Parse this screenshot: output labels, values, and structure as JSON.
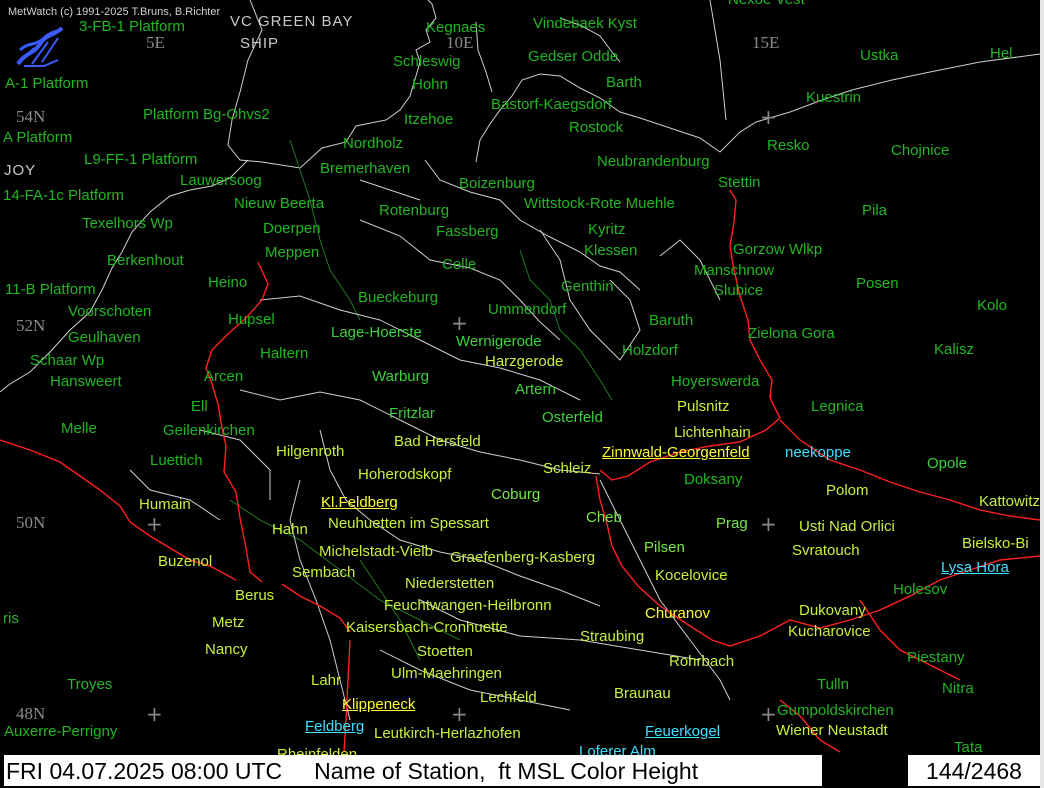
{
  "copyright": "MetWatch (c) 1991-2025 T.Bruns, B.Richter",
  "status_bar": {
    "datetime": "FRI 04.07.2025 08:00 UTC",
    "title": "Name of Station,  ft MSL Color Height",
    "counter": "144/2468"
  },
  "grid_labels": {
    "lon_5e": "5E",
    "lon_10e": "10E",
    "lon_15e": "15E",
    "lat_54n": "54N",
    "lat_52n": "52N",
    "lat_50n": "50N",
    "lat_48n": "48N"
  },
  "misc_labels": {
    "green_bay": "VC GREEN BAY",
    "ship": "SHIP",
    "joy": "JOY",
    "fragment_top": "Nexoe Vest"
  },
  "colors": {
    "coastline": "#d0d0d0",
    "border": "#ff2020",
    "admin": "#cfcfcf",
    "rivers": "#1f7a1f",
    "low": "#22b622",
    "mid": "#3ed13e",
    "highmid": "#7ae84a",
    "high": "#c8f03c",
    "mountain": "#ffff33",
    "summit": "#3fe0ff"
  },
  "stations": [
    {
      "name": "3-FB-1 Platform",
      "level": 0
    },
    {
      "name": "Kegnaes",
      "level": 0
    },
    {
      "name": "Vindebaek Kyst",
      "level": 0
    },
    {
      "name": "Ustka",
      "level": 0
    },
    {
      "name": "Hel",
      "level": 0
    },
    {
      "name": "Schleswig",
      "level": 0
    },
    {
      "name": "Gedser Odde",
      "level": 0
    },
    {
      "name": "Hohn",
      "level": 0
    },
    {
      "name": "Barth",
      "level": 0
    },
    {
      "name": "A-1 Platform",
      "level": 0
    },
    {
      "name": "Bastorf-Kaegsdorf",
      "level": 0
    },
    {
      "name": "Kuestrin",
      "level": 0
    },
    {
      "name": "Platform Bg-Ohvs2",
      "level": 0
    },
    {
      "name": "Itzehoe",
      "level": 0
    },
    {
      "name": "Rostock",
      "level": 0
    },
    {
      "name": "A Platform",
      "level": 0
    },
    {
      "name": "Nordholz",
      "level": 0
    },
    {
      "name": "Resko",
      "level": 0
    },
    {
      "name": "Chojnice",
      "level": 0
    },
    {
      "name": "L9-FF-1 Platform",
      "level": 0
    },
    {
      "name": "Neubrandenburg",
      "level": 0
    },
    {
      "name": "Bremerhaven",
      "level": 0
    },
    {
      "name": "Lauwersoog",
      "level": 0
    },
    {
      "name": "Boizenburg",
      "level": 0
    },
    {
      "name": "Stettin",
      "level": 0
    },
    {
      "name": "14-FA-1c Platform",
      "level": 0
    },
    {
      "name": "Nieuw Beerta",
      "level": 0
    },
    {
      "name": "Wittstock-Rote Muehle",
      "level": 0
    },
    {
      "name": "Rotenburg",
      "level": 0
    },
    {
      "name": "Pila",
      "level": 0
    },
    {
      "name": "Texelhors Wp",
      "level": 0
    },
    {
      "name": "Doerpen",
      "level": 0
    },
    {
      "name": "Fassberg",
      "level": 0
    },
    {
      "name": "Kyritz",
      "level": 0
    },
    {
      "name": "Gorzow Wlkp",
      "level": 0
    },
    {
      "name": "Klessen",
      "level": 0
    },
    {
      "name": "Meppen",
      "level": 0
    },
    {
      "name": "Berkenhout",
      "level": 0
    },
    {
      "name": "Celle",
      "level": 0
    },
    {
      "name": "Manschnow",
      "level": 0
    },
    {
      "name": "Heino",
      "level": 0
    },
    {
      "name": "Posen",
      "level": 0
    },
    {
      "name": "11-B Platform",
      "level": 0
    },
    {
      "name": "Genthin",
      "level": 0
    },
    {
      "name": "Slubice",
      "level": 0
    },
    {
      "name": "Bueckeburg",
      "level": 0
    },
    {
      "name": "Voorschoten",
      "level": 0
    },
    {
      "name": "Kolo",
      "level": 0
    },
    {
      "name": "Ummendorf",
      "level": 0
    },
    {
      "name": "Hupsel",
      "level": 0
    },
    {
      "name": "Baruth",
      "level": 0
    },
    {
      "name": "Lage-Hoerste",
      "level": 1
    },
    {
      "name": "Geulhaven",
      "level": 0
    },
    {
      "name": "Zielona Gora",
      "level": 0
    },
    {
      "name": "Wernigerode",
      "level": 1
    },
    {
      "name": "Holzdorf",
      "level": 0
    },
    {
      "name": "Kalisz",
      "level": 0
    },
    {
      "name": "Schaar Wp",
      "level": 0
    },
    {
      "name": "Haltern",
      "level": 0
    },
    {
      "name": "Harzgerode",
      "level": 3
    },
    {
      "name": "Hansweert",
      "level": 0
    },
    {
      "name": "Arcen",
      "level": 0
    },
    {
      "name": "Warburg",
      "level": 1
    },
    {
      "name": "Hoyerswerda",
      "level": 0
    },
    {
      "name": "Artern",
      "level": 1
    },
    {
      "name": "Ell",
      "level": 0
    },
    {
      "name": "Legnica",
      "level": 0
    },
    {
      "name": "Pulsnitz",
      "level": 3
    },
    {
      "name": "Fritzlar",
      "level": 1
    },
    {
      "name": "Osterfeld",
      "level": 1
    },
    {
      "name": "Melle",
      "level": 0
    },
    {
      "name": "Geilenkirchen",
      "level": 0
    },
    {
      "name": "Lichtenhain",
      "level": 3
    },
    {
      "name": "Bad Hersfeld",
      "level": 3
    },
    {
      "name": "Zinnwald-Georgenfeld",
      "level": 4
    },
    {
      "name": "neekoppe",
      "level": 5
    },
    {
      "name": "Hilgenroth",
      "level": 3
    },
    {
      "name": "Opole",
      "level": 1
    },
    {
      "name": "Luettich",
      "level": 0
    },
    {
      "name": "Schleiz",
      "level": 3
    },
    {
      "name": "Hoherodskopf",
      "level": 3
    },
    {
      "name": "Doksany",
      "level": 0
    },
    {
      "name": "Coburg",
      "level": 2
    },
    {
      "name": "Polom",
      "level": 3
    },
    {
      "name": "Humain",
      "level": 3
    },
    {
      "name": "Kl.Feldberg",
      "level": 4
    },
    {
      "name": "Kattowitz",
      "level": 3
    },
    {
      "name": "Neuhuetten im Spessart",
      "level": 3
    },
    {
      "name": "Cheb",
      "level": 2
    },
    {
      "name": "Prag",
      "level": 2
    },
    {
      "name": "Hahn",
      "level": 3
    },
    {
      "name": "Usti Nad Orlici",
      "level": 3
    },
    {
      "name": "Bielsko-Bi",
      "level": 3
    },
    {
      "name": "Pilsen",
      "level": 2
    },
    {
      "name": "Michelstadt-Vielb",
      "level": 3
    },
    {
      "name": "Svratouch",
      "level": 3
    },
    {
      "name": "Graefenberg-Kasberg",
      "level": 3
    },
    {
      "name": "Buzenol",
      "level": 3
    },
    {
      "name": "Lysa Hora",
      "level": 5
    },
    {
      "name": "Sembach",
      "level": 3
    },
    {
      "name": "Kocelovice",
      "level": 3
    },
    {
      "name": "Niederstetten",
      "level": 3
    },
    {
      "name": "Holesov",
      "level": 0
    },
    {
      "name": "Berus",
      "level": 3
    },
    {
      "name": "Feuchtwangen-Heilbronn",
      "level": 3
    },
    {
      "name": "Dukovany",
      "level": 3
    },
    {
      "name": "Churanov",
      "level": 4
    },
    {
      "name": "ris",
      "level": 0
    },
    {
      "name": "Metz",
      "level": 3
    },
    {
      "name": "Kaisersbach-Cronhuette",
      "level": 3
    },
    {
      "name": "Kucharovice",
      "level": 3
    },
    {
      "name": "Straubing",
      "level": 3
    },
    {
      "name": "Stoetten",
      "level": 3
    },
    {
      "name": "Nancy",
      "level": 3
    },
    {
      "name": "Piestany",
      "level": 0
    },
    {
      "name": "Rohrbach",
      "level": 3
    },
    {
      "name": "Ulm-Maehringen",
      "level": 3
    },
    {
      "name": "Nitra",
      "level": 0
    },
    {
      "name": "Troyes",
      "level": 0
    },
    {
      "name": "Lahr",
      "level": 3
    },
    {
      "name": "Tulln",
      "level": 0
    },
    {
      "name": "Braunau",
      "level": 3
    },
    {
      "name": "Lechfeld",
      "level": 3
    },
    {
      "name": "Gumpoldskirchen",
      "level": 0
    },
    {
      "name": "Klippeneck",
      "level": 4
    },
    {
      "name": "Feldberg",
      "level": 5
    },
    {
      "name": "Feuerkogel",
      "level": 5
    },
    {
      "name": "Wiener Neustadt",
      "level": 3
    },
    {
      "name": "Leutkirch-Herlazhofen",
      "level": 3
    },
    {
      "name": "Auxerre-Perrigny",
      "level": 0
    },
    {
      "name": "Tata",
      "level": 0
    },
    {
      "name": "Loferer Alm",
      "level": 5
    },
    {
      "name": "Rheinfelden",
      "level": 3
    }
  ]
}
